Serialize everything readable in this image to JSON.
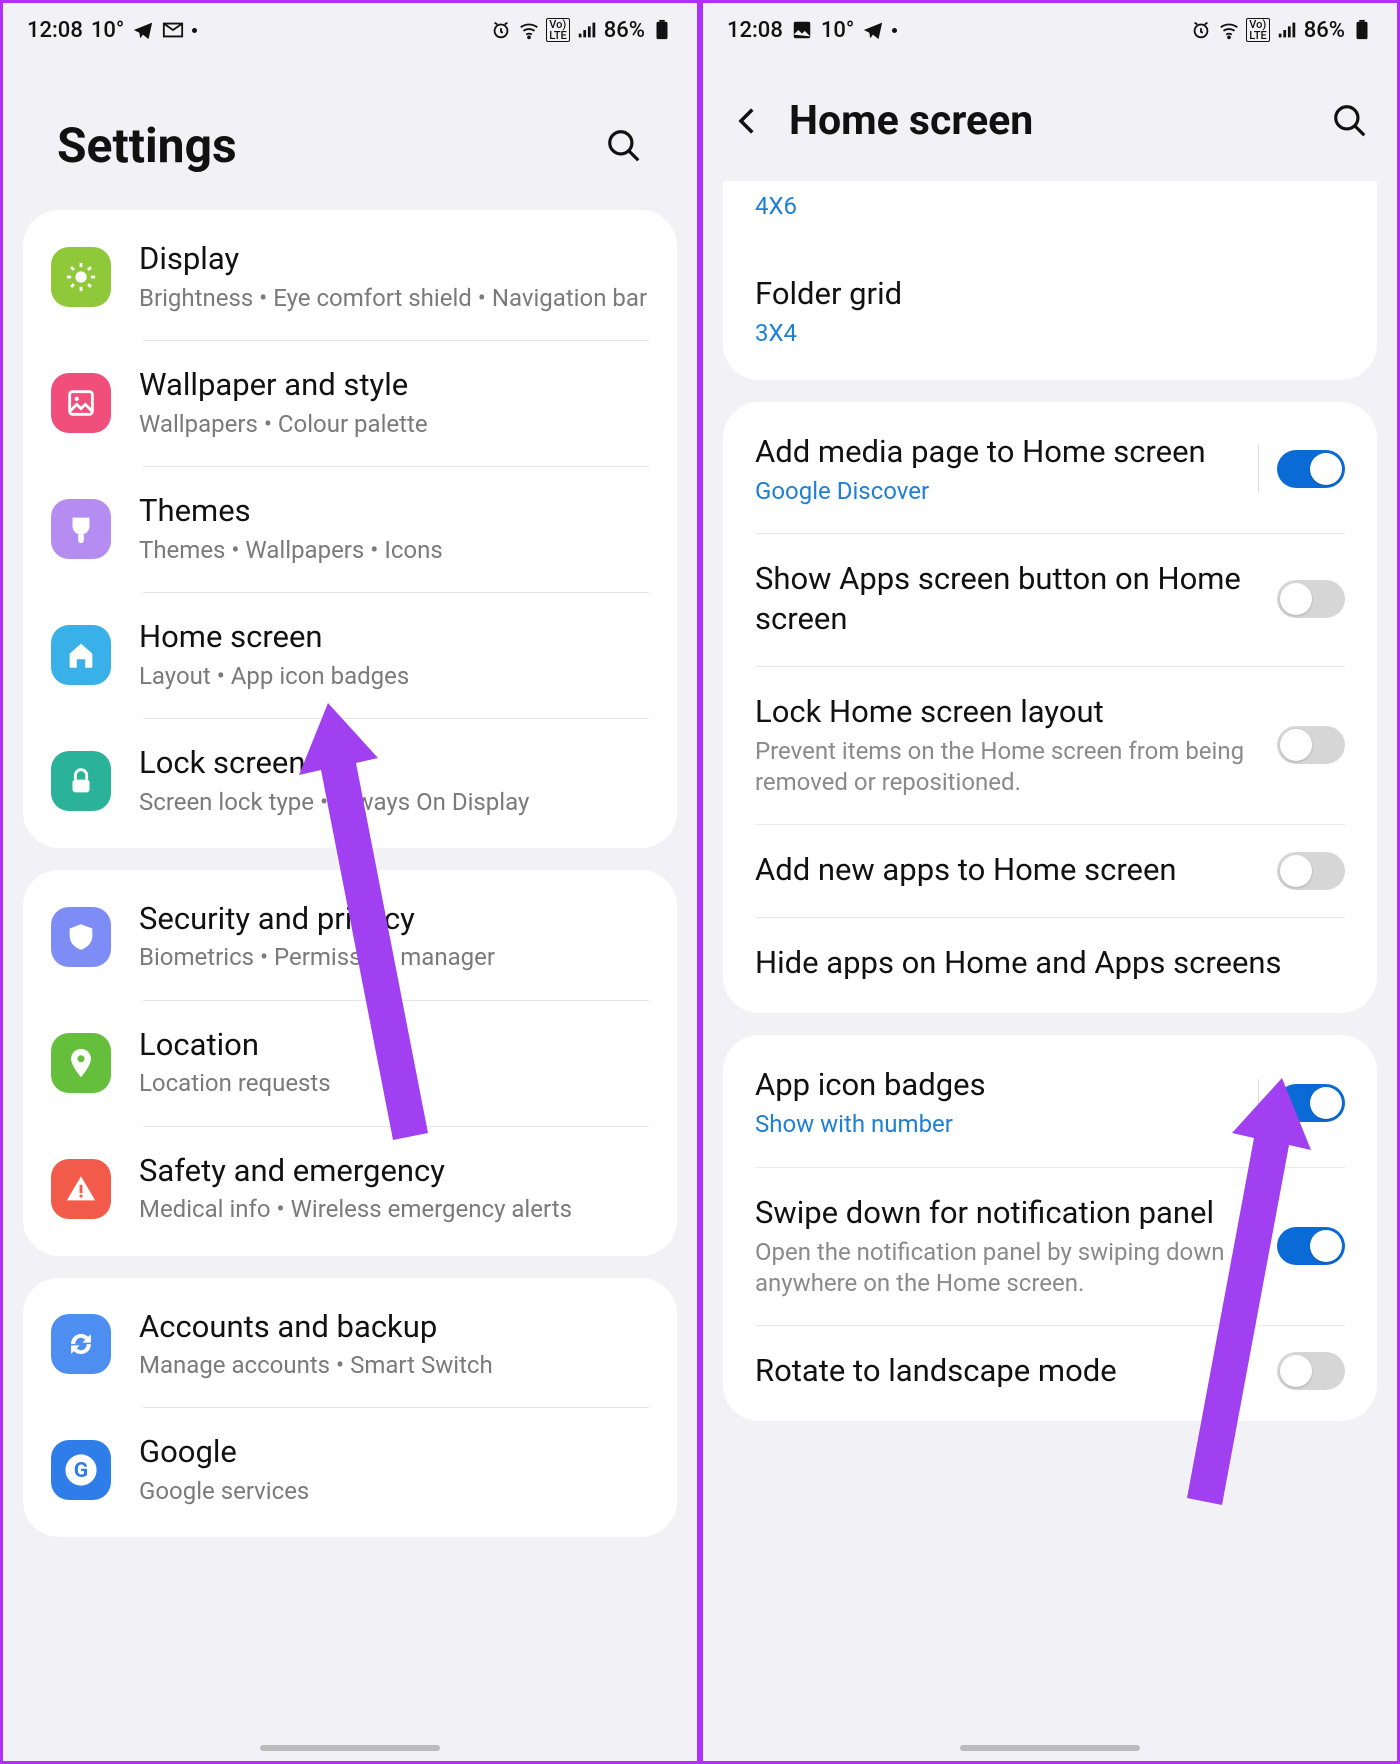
{
  "left": {
    "status": {
      "time": "12:08",
      "temp": "10°",
      "battery": "86%"
    },
    "title": "Settings",
    "groups": [
      [
        {
          "icon": "sun",
          "color": "#8fc93a",
          "title": "Display",
          "sub": "Brightness  •  Eye comfort shield  •  Navigation bar"
        },
        {
          "icon": "image",
          "color": "#f04e7b",
          "title": "Wallpaper and style",
          "sub": "Wallpapers  •  Colour palette"
        },
        {
          "icon": "brush",
          "color": "#b48cf2",
          "title": "Themes",
          "sub": "Themes  •  Wallpapers  •  Icons"
        },
        {
          "icon": "home",
          "color": "#3ab0e8",
          "title": "Home screen",
          "sub": "Layout  •  App icon badges"
        },
        {
          "icon": "lock",
          "color": "#2bb39a",
          "title": "Lock screen",
          "sub": "Screen lock type  •  Always On Display"
        }
      ],
      [
        {
          "icon": "shield",
          "color": "#7d8df5",
          "title": "Security and privacy",
          "sub": "Biometrics  •  Permission manager"
        },
        {
          "icon": "pin",
          "color": "#66bf3c",
          "title": "Location",
          "sub": "Location requests"
        },
        {
          "icon": "alert",
          "color": "#f25b4a",
          "title": "Safety and emergency",
          "sub": "Medical info  •  Wireless emergency alerts"
        }
      ],
      [
        {
          "icon": "sync",
          "color": "#4d8ef0",
          "title": "Accounts and backup",
          "sub": "Manage accounts  •  Smart Switch"
        },
        {
          "icon": "google",
          "color": "#2f7de8",
          "title": "Google",
          "sub": "Google services"
        }
      ]
    ]
  },
  "right": {
    "status": {
      "time": "12:08",
      "temp": "10°",
      "battery": "86%"
    },
    "title": "Home screen",
    "topPartial": {
      "value": "4X6"
    },
    "folderGrid": {
      "title": "Folder grid",
      "value": "3X4"
    },
    "rows": [
      {
        "title": "Add media page to Home screen",
        "sub": "Google Discover",
        "blue": true,
        "toggle": "on",
        "vline": true
      },
      {
        "title": "Show Apps screen button on Home screen",
        "toggle": "off"
      },
      {
        "title": "Lock Home screen layout",
        "sub": "Prevent items on the Home screen from being removed or repositioned.",
        "toggle": "off"
      },
      {
        "title": "Add new apps to Home screen",
        "toggle": "off"
      },
      {
        "title": "Hide apps on Home and Apps screens"
      }
    ],
    "rows2": [
      {
        "title": "App icon badges",
        "sub": "Show with number",
        "blue": true,
        "toggle": "on",
        "vline": true
      },
      {
        "title": "Swipe down for notification panel",
        "sub": "Open the notification panel by swiping down anywhere on the Home screen.",
        "toggle": "on"
      },
      {
        "title": "Rotate to landscape mode",
        "toggle": "off"
      }
    ]
  }
}
